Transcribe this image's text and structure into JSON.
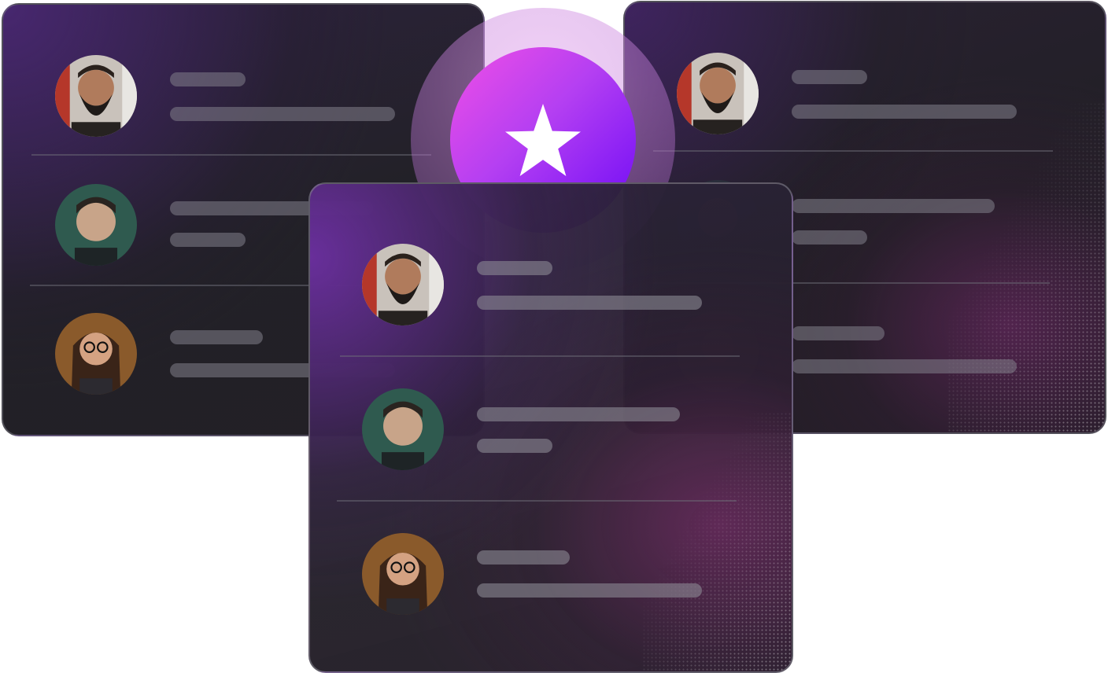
{
  "badge": {
    "icon": "star-icon",
    "gradient_start": "#f04fe6",
    "gradient_end": "#6b08f6"
  },
  "cards": [
    {
      "name": "left",
      "rows": [
        "bearded-man",
        "young-man",
        "woman-glasses"
      ]
    },
    {
      "name": "right",
      "rows": [
        "bearded-man",
        "young-man",
        "woman-glasses"
      ]
    },
    {
      "name": "center",
      "rows": [
        "bearded-man",
        "young-man",
        "woman-glasses"
      ]
    }
  ],
  "colors": {
    "card_bg": "#222127",
    "accent_purple": "#7a2fc0",
    "placeholder_line": "#7e7c86"
  }
}
